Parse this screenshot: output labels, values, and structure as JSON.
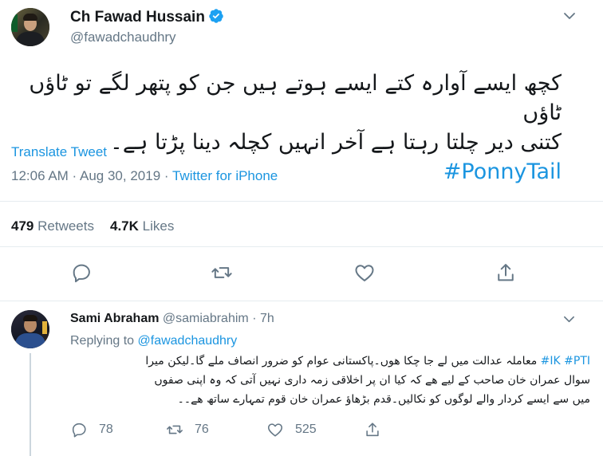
{
  "main_tweet": {
    "author_name": "Ch Fawad Hussain",
    "author_handle": "@fawadchaudhry",
    "verified": true,
    "text_line1": "کچھ ایسے آوارہ کتے ایسے ہوتے ہیں جن کو پتھر لگے تو ٹاؤں ٹاؤں",
    "text_line2": "کتنی دیر چلتا رہتا ہے آخر انہیں کچلہ دینا پڑتا ہے۔",
    "hashtag": "#PonnyTail",
    "translate_label": "Translate Tweet",
    "time": "12:06 AM",
    "date": "Aug 30, 2019",
    "separator": " · ",
    "source": "Twitter for iPhone",
    "retweets_count": "479",
    "retweets_label": "Retweets",
    "likes_count": "4.7K",
    "likes_label": "Likes",
    "actions": [
      "reply-icon",
      "retweet-icon",
      "like-icon",
      "share-icon"
    ]
  },
  "reply_tweet": {
    "author_name": "Sami Abraham",
    "author_handle": "@samiabrahim",
    "dot": "·",
    "time_ago": "7h",
    "replying_prefix": "Replying to",
    "replying_to": "@fawadchaudhry",
    "hashtags": "#IK #PTI",
    "text_line1": "معاملہ عدالت میں لے جا چکا ھوں۔پاکستانی عوام کو ضرور انصاف ملے گا۔لیکن میرا",
    "text_line2": "سوال عمران خان صاحب کے لیے ھے کہ کیا ان پر اخلاقی زمہ داری نہیں آتی کہ وہ اپنی صفوں",
    "text_line3": "میں سے ایسے کردار والے لوگوں کو نکالیں۔قدم بڑھاؤ عمران خان قوم تمہارے ساتھ ھے۔۔",
    "reply_count": "78",
    "retweet_count": "76",
    "like_count": "525"
  },
  "colors": {
    "link": "#1b95e0",
    "secondary_text": "#657786",
    "primary_text": "#14171a",
    "divider": "#e6ecf0"
  }
}
